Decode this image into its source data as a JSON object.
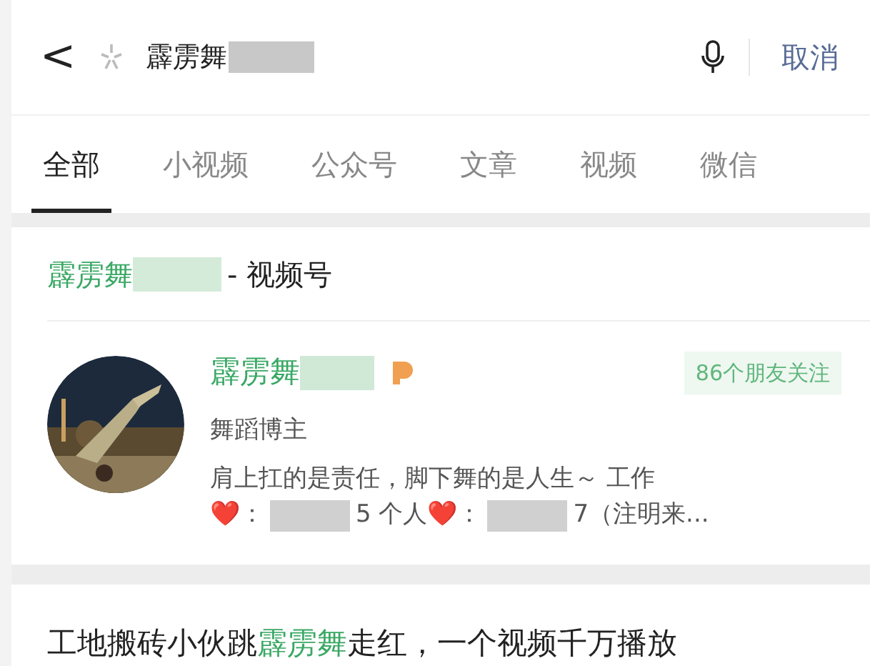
{
  "search": {
    "back": "<",
    "query": "霹雳舞",
    "cancel": "取消"
  },
  "tabs": [
    {
      "label": "全部",
      "selected": true
    },
    {
      "label": "小视频",
      "selected": false
    },
    {
      "label": "公众号",
      "selected": false
    },
    {
      "label": "文章",
      "selected": false
    },
    {
      "label": "视频",
      "selected": false
    },
    {
      "label": "微信",
      "selected": false
    }
  ],
  "section": {
    "segments": [
      {
        "text": "霹雳舞",
        "highlight": true,
        "kind": "text"
      },
      {
        "kind": "redacted",
        "highlight": true
      },
      {
        "text": "- 视频号",
        "highlight": false,
        "kind": "text"
      }
    ]
  },
  "account": {
    "name": "霹雳舞",
    "followers": "86个朋友关注",
    "category": "舞蹈博主",
    "bio_line_1": "肩上扛的是责任，脚下舞的是人生～ 工作",
    "bio_line_2": [
      {
        "kind": "text",
        "text": "❤️："
      },
      {
        "kind": "redacted"
      },
      {
        "kind": "text",
        "text": "5 个人❤️："
      },
      {
        "kind": "redacted"
      },
      {
        "kind": "text",
        "text": "7（注明来..."
      }
    ]
  },
  "article": {
    "segments": [
      {
        "text": "工地搬砖小伙跳",
        "highlight": false
      },
      {
        "text": "霹雳舞",
        "highlight": true
      },
      {
        "text": "走红，一个视频千万播放",
        "highlight": false
      }
    ]
  }
}
